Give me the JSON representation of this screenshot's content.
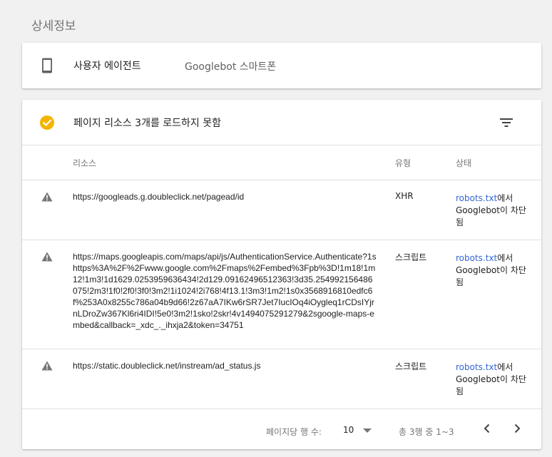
{
  "section_title": "상세정보",
  "user_agent": {
    "label": "사용자 에이전트",
    "value": "Googlebot 스마트폰",
    "icon": "smartphone-icon"
  },
  "resources": {
    "title": "페이지 리소스 3개를 로드하지 못함",
    "status_icon": "check-circle-icon",
    "filter_icon": "filter-list-icon",
    "columns": {
      "resource": "리소스",
      "type": "유형",
      "status": "상태"
    },
    "rows": [
      {
        "url": "https://googleads.g.doubleclick.net/pagead/id",
        "type": "XHR",
        "status_link": "robots.txt",
        "status_text": "에서 Googlebot이 차단됨"
      },
      {
        "url": "https://maps.googleapis.com/maps/api/js/AuthenticationService.Authenticate?1shttps%3A%2F%2Fwww.google.com%2Fmaps%2Fembed%3Fpb%3D!1m18!1m12!1m3!1d1629.0253959636434!2d129.09162496512363!3d35.254992156486075!2m3!1f0!2f0!3f0!3m2!1i1024!2i768!4f13.1!3m3!1m2!1s0x3568916810edfc6f%253A0x8255c786a04b9d66!2z67aA7IKw6rSR7Jet7IucIOq4iOygleq1rCDsIYjrnLDroZw367Kl6ri4IDI!5e0!3m2!1sko!2skr!4v1494075291279&2sgoogle-maps-embed&callback=_xdc_._ihxja2&token=34751",
        "type": "스크립트",
        "status_link": "robots.txt",
        "status_text": "에서 Googlebot이 차단됨"
      },
      {
        "url": "https://static.doubleclick.net/instream/ad_status.js",
        "type": "스크립트",
        "status_link": "robots.txt",
        "status_text": "에서 Googlebot이 차단됨"
      }
    ]
  },
  "pagination": {
    "rows_per_page_label": "페이지당 행 수:",
    "rows_per_page_value": "10",
    "range_text": "총 3행 중 1~3"
  },
  "colors": {
    "accent_yellow": "#f4b400",
    "link_blue": "#3367d6",
    "warning_gray": "#757575"
  }
}
